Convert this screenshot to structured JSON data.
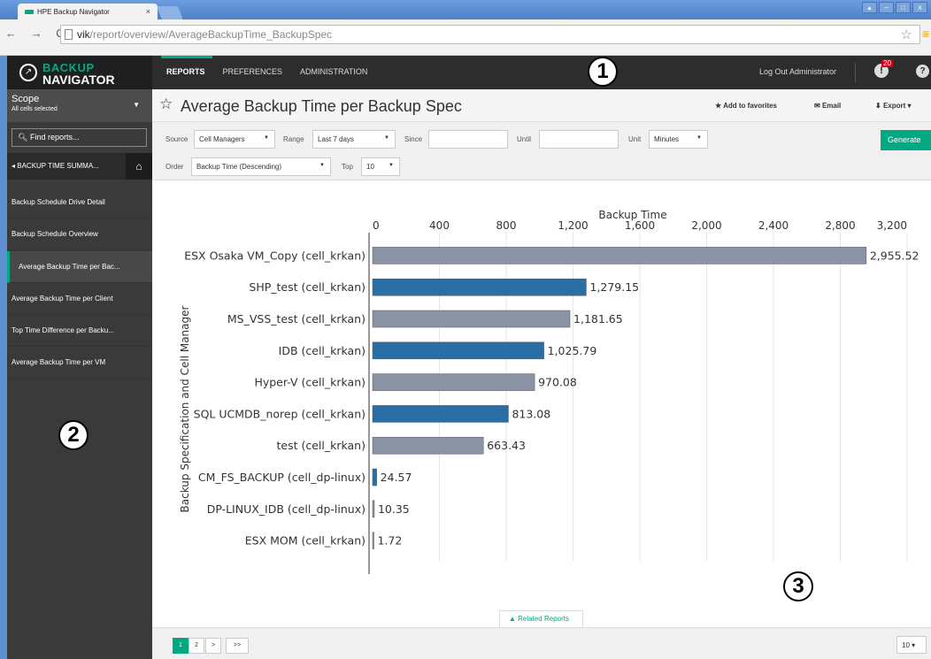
{
  "browser": {
    "tab_title": "HPE Backup Navigator",
    "tab_close": "×",
    "url_host": "vik",
    "url_path": "/report/overview/AverageBackupTime_BackupSpec",
    "nav": "← → C"
  },
  "app": {
    "logo_line1": "BACKUP",
    "logo_line2": "NAVIGATOR",
    "nav": [
      "REPORTS",
      "PREFERENCES",
      "ADMINISTRATION"
    ],
    "logout": "Log Out Administrator",
    "alert_count": "20",
    "help": "?"
  },
  "sidebar": {
    "scope_title": "Scope",
    "scope_subtitle": "All cells selected",
    "find": "Find reports...",
    "section": "◂ BACKUP TIME SUMMA...",
    "items": [
      "Backup Schedule Drive Detail",
      "Backup Schedule Overview",
      "Average Backup Time per Bac...",
      "Average Backup Time per Client",
      "Top Time Difference per Backu...",
      "Average Backup Time per VM"
    ]
  },
  "report": {
    "title": "Average Backup Time per Backup Spec",
    "add_fav": "Add to favorites",
    "email": "Email",
    "export": "Export",
    "filters": {
      "source_label": "Source",
      "source": "Cell Managers",
      "range_label": "Range",
      "range": "Last 7 days",
      "since_label": "Since",
      "until_label": "Until",
      "unit_label": "Unit",
      "unit": "Minutes",
      "order_label": "Order",
      "order": "Backup Time (Descending)",
      "top_label": "Top",
      "top": "10"
    },
    "generate": "Generate",
    "related": "Related Reports",
    "pages": [
      "1",
      "2",
      ">",
      ">>"
    ],
    "page_size": "10"
  },
  "callouts": [
    "1",
    "2",
    "3"
  ],
  "colors": {
    "accent": "#01a982",
    "bar_blue": "#2a6ea6",
    "bar_gray": "#8a93a4"
  },
  "chart_data": {
    "type": "bar",
    "orientation": "horizontal",
    "xlabel": "Backup Time",
    "ylabel": "Backup Specification and Cell Manager",
    "xlim": [
      0,
      3200
    ],
    "xticks": [
      "0",
      "400",
      "800",
      "1,200",
      "1,600",
      "2,000",
      "2,400",
      "2,800",
      "3,200"
    ],
    "grid": true,
    "categories": [
      "ESX Osaka VM_Copy (cell_krkan)",
      "SHP_test (cell_krkan)",
      "MS_VSS_test (cell_krkan)",
      "IDB (cell_krkan)",
      "Hyper-V (cell_krkan)",
      "SQL UCMDB_norep (cell_krkan)",
      "test (cell_krkan)",
      "CM_FS_BACKUP (cell_dp-linux)",
      "DP-LINUX_IDB (cell_dp-linux)",
      "ESX MOM (cell_krkan)"
    ],
    "values": [
      2955.52,
      1279.15,
      1181.65,
      1025.79,
      970.08,
      813.08,
      663.43,
      24.57,
      10.35,
      1.72
    ],
    "labels": [
      "2,955.52",
      "1,279.15",
      "1,181.65",
      "1,025.79",
      "970.08",
      "813.08",
      "663.43",
      "24.57",
      "10.35",
      "1.72"
    ],
    "bar_colors": [
      "gray",
      "blue",
      "gray",
      "blue",
      "gray",
      "blue",
      "gray",
      "blue",
      "gray",
      "gray"
    ]
  }
}
